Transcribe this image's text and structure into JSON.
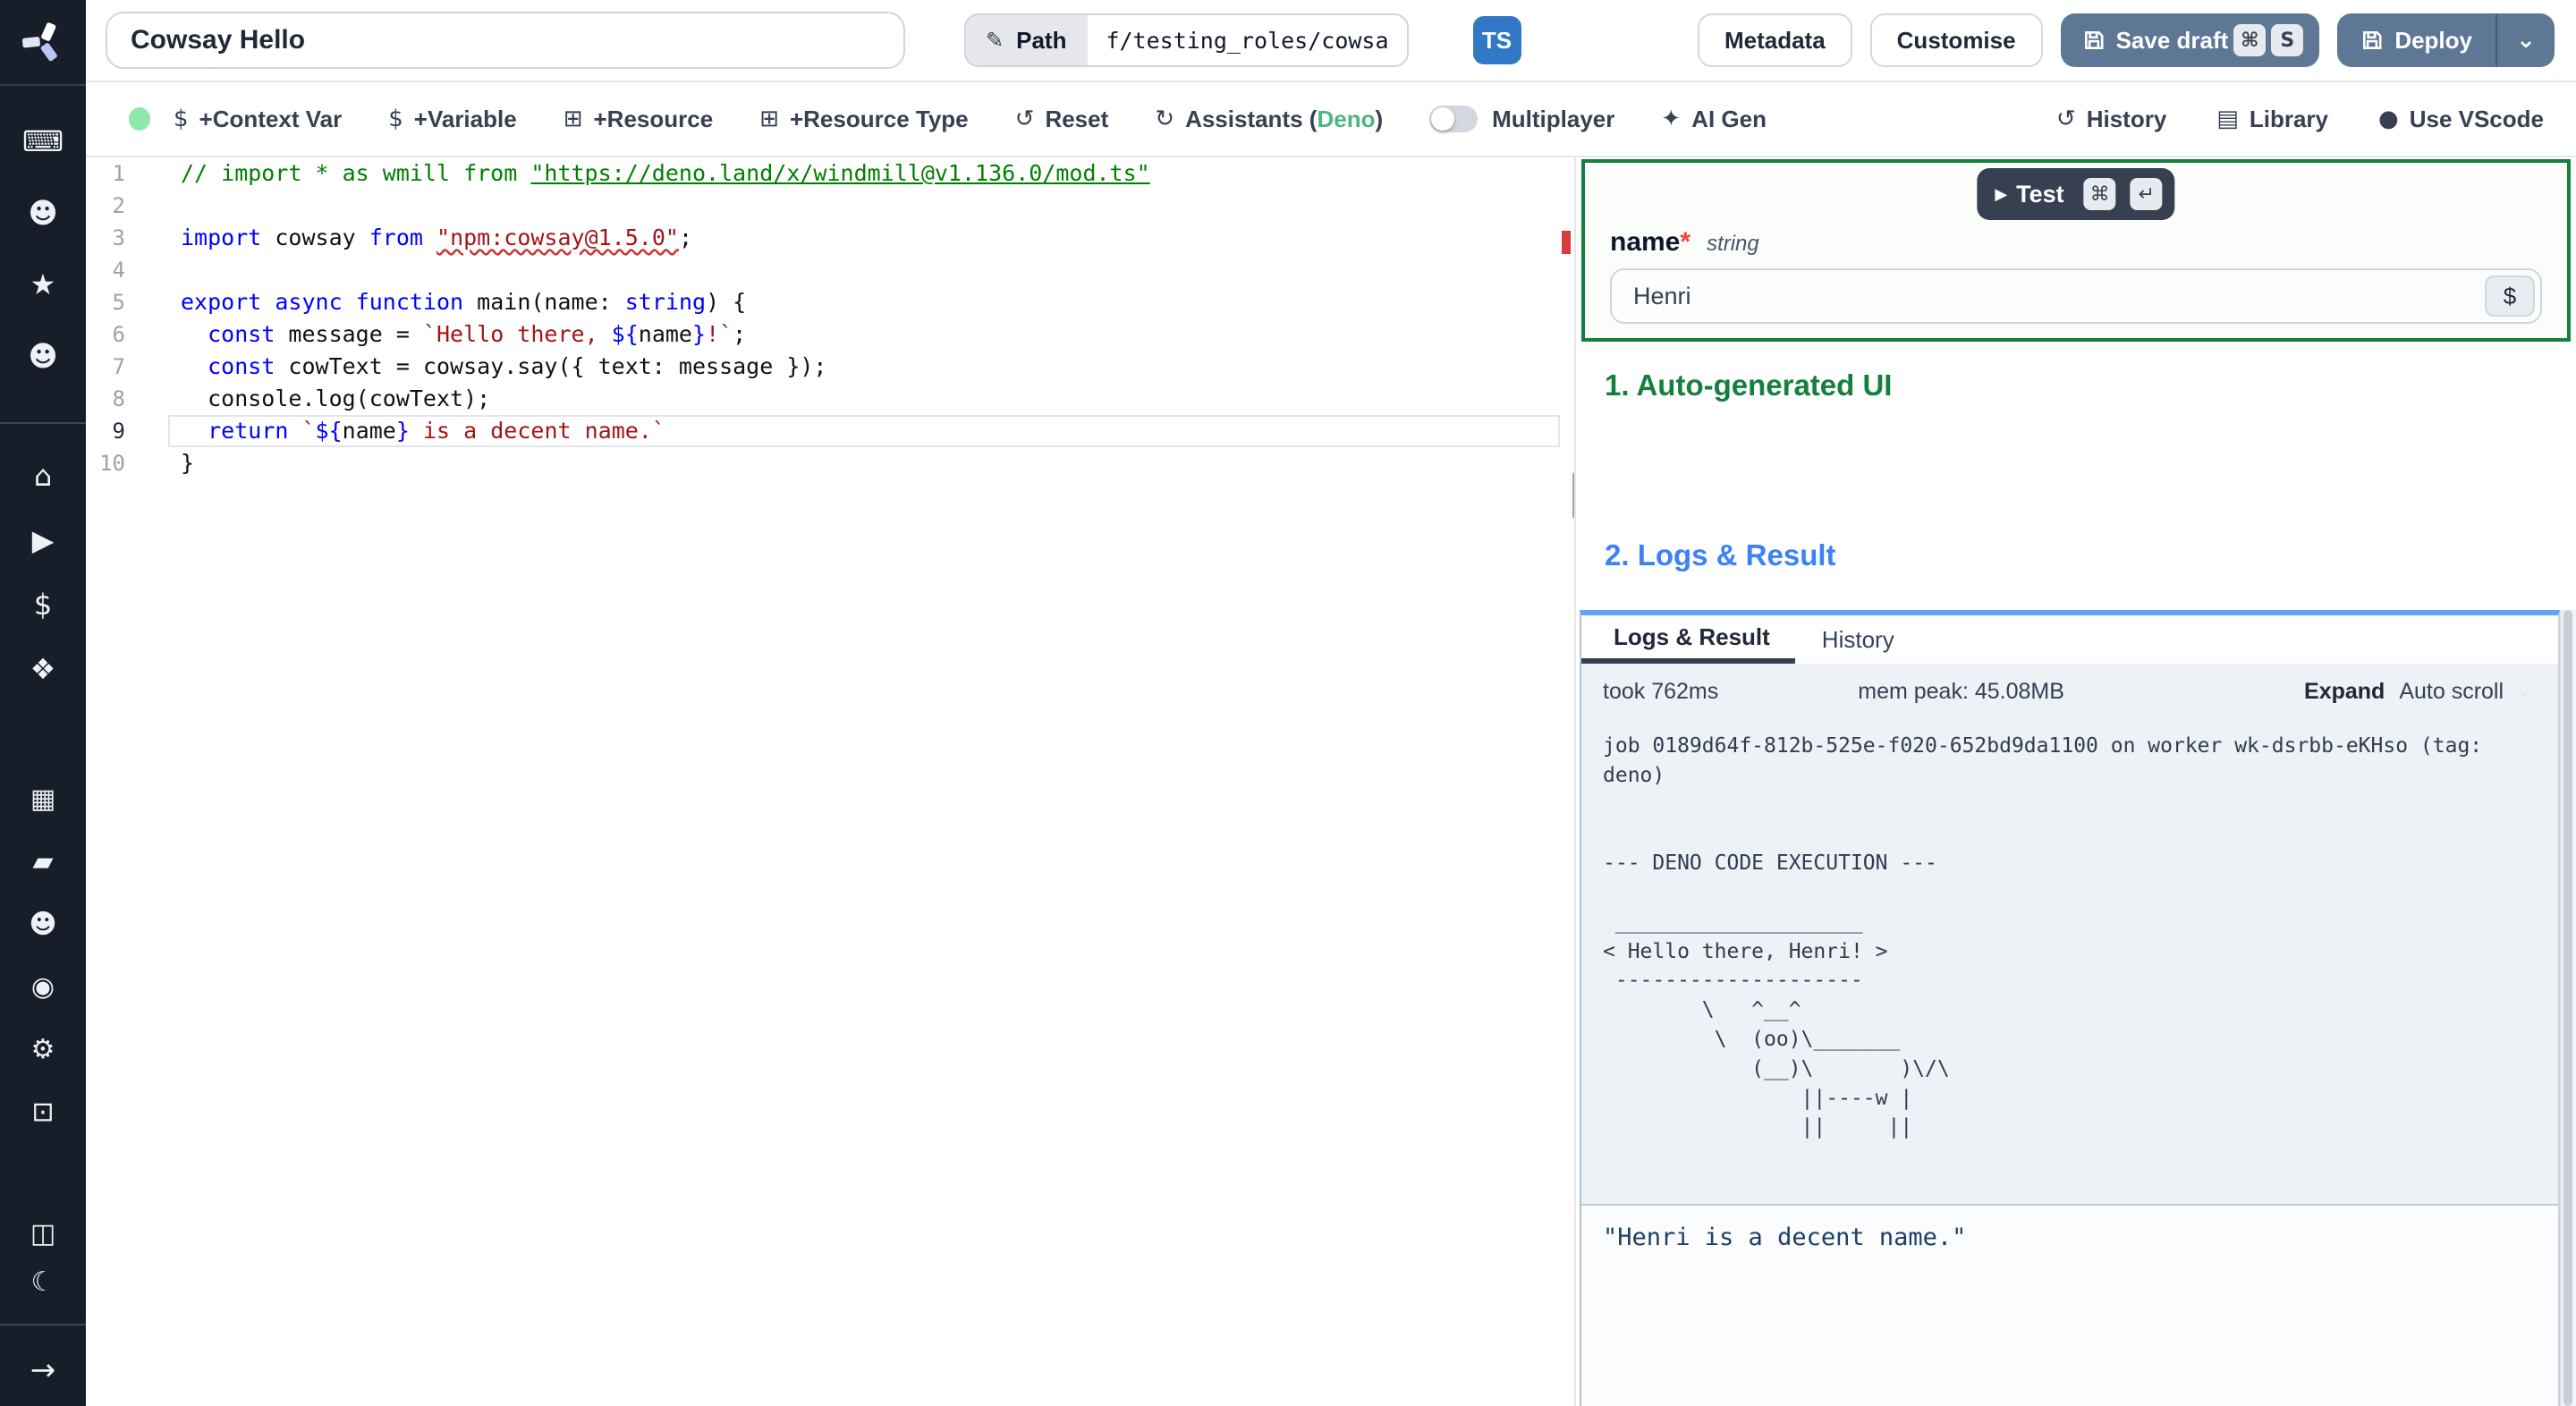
{
  "colors": {
    "accent_button": "#5d7795",
    "ts_badge": "#3178c6",
    "green_heading": "#15803d",
    "blue_heading": "#3b82f6",
    "deno_accent": "#4cb782",
    "error_red": "#cd3131"
  },
  "sidebar": {
    "groups": [
      [
        {
          "name": "workspace-icon",
          "glyph": "⌨"
        },
        {
          "name": "user-icon",
          "glyph": "☻"
        },
        {
          "name": "favorites-star-icon",
          "glyph": "★"
        },
        {
          "name": "users-icon",
          "glyph": "☻"
        }
      ],
      [
        {
          "name": "home-icon",
          "glyph": "⌂"
        },
        {
          "name": "runs-icon",
          "glyph": "▶"
        },
        {
          "name": "variables-icon",
          "glyph": "$"
        },
        {
          "name": "resources-icon",
          "glyph": "❖"
        }
      ],
      [
        {
          "name": "schedules-icon",
          "glyph": "▦"
        },
        {
          "name": "folders-icon",
          "glyph": "▰"
        },
        {
          "name": "groups-icon",
          "glyph": "☻"
        },
        {
          "name": "audit-logs-icon",
          "glyph": "◉"
        },
        {
          "name": "settings-icon",
          "glyph": "⚙"
        },
        {
          "name": "workers-icon",
          "glyph": "⊡"
        }
      ],
      [
        {
          "name": "docs-icon",
          "glyph": "◫"
        },
        {
          "name": "dark-mode-icon",
          "glyph": "☾"
        }
      ]
    ],
    "bottom": {
      "name": "collapse-sidebar-icon",
      "glyph": "→"
    }
  },
  "topbar": {
    "title": "Cowsay Hello",
    "path_label": "Path",
    "path_value": "f/testing_roles/cowsa",
    "language_badge": "TS",
    "metadata_label": "Metadata",
    "customise_label": "Customise",
    "save_draft": {
      "label": "Save draft",
      "kbd": [
        "⌘",
        "S"
      ]
    },
    "deploy": {
      "label": "Deploy",
      "caret": "⌄"
    }
  },
  "toolbar": {
    "left": [
      {
        "type": "dot",
        "name": "status-dot"
      },
      {
        "type": "btn",
        "name": "add-context-var-button",
        "glyph": "$",
        "label": "+Context Var"
      },
      {
        "type": "btn",
        "name": "add-variable-button",
        "glyph": "$",
        "label": "+Variable"
      },
      {
        "type": "btn",
        "name": "add-resource-button",
        "glyph": "⊞",
        "label": "+Resource"
      },
      {
        "type": "btn",
        "name": "add-resource-type-button",
        "glyph": "⊞",
        "label": "+Resource Type"
      },
      {
        "type": "btn",
        "name": "reset-button",
        "glyph": "↺",
        "label": "Reset"
      },
      {
        "type": "btn",
        "name": "assistants-button",
        "glyph": "↻",
        "label": "Assistants (",
        "accent": "Deno",
        "suffix": ")"
      },
      {
        "type": "toggle",
        "name": "multiplayer-toggle",
        "label": "Multiplayer"
      },
      {
        "type": "btn",
        "name": "ai-gen-button",
        "glyph": "✦",
        "label": "AI Gen"
      }
    ],
    "right": [
      {
        "name": "history-button",
        "glyph": "↺",
        "label": "History"
      },
      {
        "name": "library-button",
        "glyph": "▤",
        "label": "Library"
      },
      {
        "name": "use-vscode-button",
        "glyph": "●",
        "label": "Use VScode"
      }
    ]
  },
  "editor": {
    "lines": [
      {
        "n": "1",
        "tokens": [
          [
            "cm",
            "// import * as wmill from "
          ],
          [
            "cm link",
            "\"https://deno.land/x/windmill@v1.136.0/mod.ts\""
          ]
        ]
      },
      {
        "n": "2",
        "tokens": []
      },
      {
        "n": "3",
        "tokens": [
          [
            "kw",
            "import"
          ],
          [
            "pl",
            " cowsay "
          ],
          [
            "kw",
            "from"
          ],
          [
            "pl",
            " "
          ],
          [
            "str err",
            "\"npm:cowsay@1.5.0\""
          ],
          [
            "pl",
            ";"
          ]
        ]
      },
      {
        "n": "4",
        "tokens": []
      },
      {
        "n": "5",
        "tokens": [
          [
            "kw",
            "export"
          ],
          [
            "pl",
            " "
          ],
          [
            "kw",
            "async"
          ],
          [
            "pl",
            " "
          ],
          [
            "kw",
            "function"
          ],
          [
            "pl",
            " main(name: "
          ],
          [
            "kw",
            "string"
          ],
          [
            "pl",
            ") {"
          ]
        ]
      },
      {
        "n": "6",
        "tokens": [
          [
            "pl",
            "  "
          ],
          [
            "kw",
            "const"
          ],
          [
            "pl",
            " message = "
          ],
          [
            "str",
            "`Hello there, "
          ],
          [
            "tpl",
            "${"
          ],
          [
            "pl",
            "name"
          ],
          [
            "tpl",
            "}"
          ],
          [
            "str",
            "!`"
          ],
          [
            "pl",
            ";"
          ]
        ]
      },
      {
        "n": "7",
        "tokens": [
          [
            "pl",
            "  "
          ],
          [
            "kw",
            "const"
          ],
          [
            "pl",
            " cowText = cowsay.say({ text: message });"
          ]
        ]
      },
      {
        "n": "8",
        "tokens": [
          [
            "pl",
            "  console.log(cowText);"
          ]
        ]
      },
      {
        "n": "9",
        "current": true,
        "tokens": [
          [
            "pl",
            "  "
          ],
          [
            "kw",
            "return"
          ],
          [
            "pl",
            " "
          ],
          [
            "str",
            "`"
          ],
          [
            "tpl",
            "${"
          ],
          [
            "pl",
            "name"
          ],
          [
            "tpl",
            "}"
          ],
          [
            "str",
            " is a decent name.`"
          ]
        ]
      },
      {
        "n": "10",
        "tokens": [
          [
            "pl",
            "}"
          ]
        ]
      }
    ]
  },
  "preview": {
    "test": {
      "label": "Test",
      "play": "▶",
      "kbd": [
        "⌘",
        "↵"
      ]
    },
    "field": {
      "name": "name",
      "required": "*",
      "type": "string",
      "value": "Henri",
      "dollar": "$"
    },
    "section1": "1. Auto-generated UI",
    "section2": "2. Logs & Result",
    "tabs": [
      "Logs & Result",
      "History"
    ],
    "meta": {
      "took": "took 762ms",
      "mem": "mem peak: 45.08MB",
      "expand": "Expand",
      "autoscroll": "Auto scroll",
      "check": "✓"
    },
    "logs": "job 0189d64f-812b-525e-f020-652bd9da1100 on worker wk-dsrbb-eKHso (tag:\ndeno)\n\n\n--- DENO CODE EXECUTION ---\n\n ____________________\n< Hello there, Henri! >\n --------------------\n        \\   ^__^\n         \\  (oo)\\_______\n            (__)\\       )\\/\\\n                ||----w |\n                ||     ||",
    "result": "\"Henri is a decent name.\""
  }
}
